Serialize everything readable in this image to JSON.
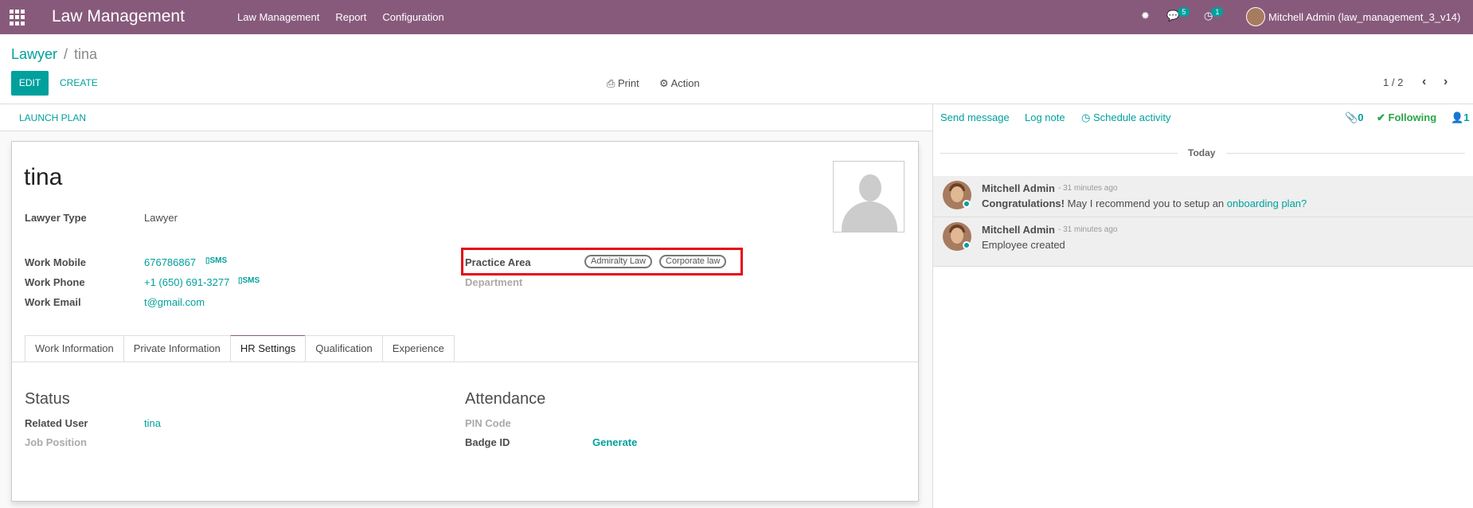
{
  "navbar": {
    "brand": "Law Management",
    "menu": [
      "Law Management",
      "Report",
      "Configuration"
    ],
    "messages_count": "5",
    "activities_count": "1",
    "user_name": "Mitchell Admin (law_management_3_v14)"
  },
  "breadcrumb": {
    "parent": "Lawyer",
    "current": "tina"
  },
  "toolbar": {
    "edit": "EDIT",
    "create": "CREATE",
    "print": "Print",
    "action": "Action",
    "pager": "1 / 2"
  },
  "statusbar": {
    "launch_plan": "LAUNCH PLAN"
  },
  "form": {
    "name": "tina",
    "lawyer_type_label": "Lawyer Type",
    "lawyer_type": "Lawyer",
    "work_mobile_label": "Work Mobile",
    "work_mobile": "676786867",
    "work_phone_label": "Work Phone",
    "work_phone": "+1 (650) 691-3277",
    "work_email_label": "Work Email",
    "work_email": "t@gmail.com",
    "sms_label": "SMS",
    "practice_area_label": "Practice Area",
    "practice_area_tags": [
      "Admiralty Law",
      "Corporate law"
    ],
    "department_label": "Department"
  },
  "tabs": [
    "Work Information",
    "Private Information",
    "HR Settings",
    "Qualification",
    "Experience"
  ],
  "hr_settings": {
    "status_title": "Status",
    "related_user_label": "Related User",
    "related_user": "tina",
    "job_position_label": "Job Position",
    "attendance_title": "Attendance",
    "pin_code_label": "PIN Code",
    "badge_id_label": "Badge ID",
    "generate": "Generate"
  },
  "chatter": {
    "send_message": "Send message",
    "log_note": "Log note",
    "schedule_activity": "Schedule activity",
    "attachments": "0",
    "following": "Following",
    "followers": "1",
    "today": "Today",
    "messages": [
      {
        "author": "Mitchell Admin",
        "time": "- 31 minutes ago",
        "bold": "Congratulations!",
        "text": " May I recommend you to setup an ",
        "link": "onboarding plan?"
      },
      {
        "author": "Mitchell Admin",
        "time": "- 31 minutes ago",
        "text": "Employee created"
      }
    ]
  }
}
